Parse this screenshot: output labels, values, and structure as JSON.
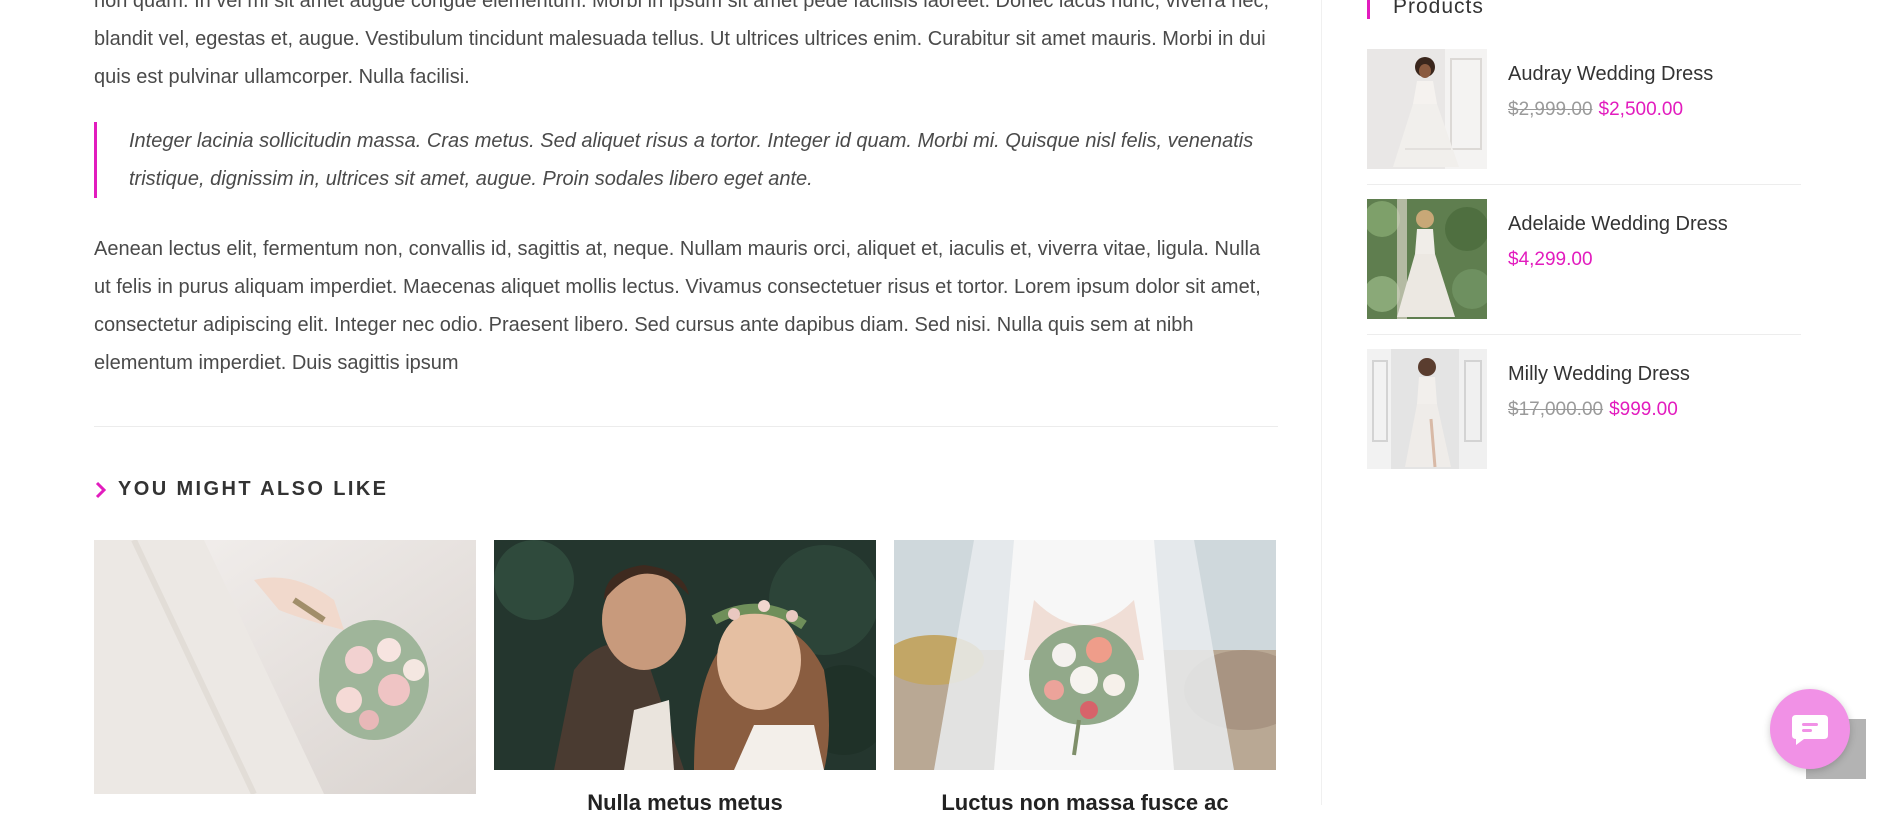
{
  "article": {
    "para_top": "non quam. In vel mi sit amet augue congue elementum. Morbi in ipsum sit amet pede facilisis laoreet. Donec lacus nunc, viverra nec, blandit vel, egestas et, augue. Vestibulum tincidunt malesuada tellus. Ut ultrices ultrices enim. Curabitur sit amet mauris. Morbi in dui quis est pulvinar ullamcorper. Nulla facilisi.",
    "blockquote": "Integer lacinia sollicitudin massa. Cras metus. Sed aliquet risus a tortor. Integer id quam. Morbi mi. Quisque nisl felis, venenatis tristique, dignissim in, ultrices sit amet, augue. Proin sodales libero eget ante.",
    "para_bottom": "Aenean lectus elit, fermentum non, convallis id, sagittis at, neque. Nullam mauris orci, aliquet et, iaculis et, viverra vitae, ligula. Nulla ut felis in purus aliquam imperdiet. Maecenas aliquet mollis lectus. Vivamus consectetuer risus et tortor. Lorem ipsum dolor sit amet, consectetur adipiscing elit. Integer nec odio. Praesent libero. Sed cursus ante dapibus diam. Sed nisi. Nulla quis sem at nibh elementum imperdiet. Duis sagittis ipsum"
  },
  "related": {
    "heading": "YOU MIGHT ALSO LIKE",
    "cards": [
      {
        "title": "",
        "image": "bride-holding-bouquet"
      },
      {
        "title": "Nulla metus metus",
        "image": "couple-embracing"
      },
      {
        "title": "Luctus non massa fusce ac",
        "image": "bride-bouquet-veil"
      }
    ]
  },
  "sidebar": {
    "widget_title": "Products",
    "products": [
      {
        "name": "Audray Wedding Dress",
        "old_price": "$2,999.00",
        "price": "$2,500.00"
      },
      {
        "name": "Adelaide Wedding Dress",
        "old_price": "",
        "price": "$4,299.00"
      },
      {
        "name": "Milly Wedding Dress",
        "old_price": "$17,000.00",
        "price": "$999.00"
      }
    ]
  },
  "colors": {
    "accent": "#e21cbe",
    "text": "#4a4a4a",
    "chat": "#f191e6"
  },
  "icons": {
    "heading": "chevron-right-icon",
    "chat": "chat-icon",
    "scroll": "scroll-to-top"
  }
}
